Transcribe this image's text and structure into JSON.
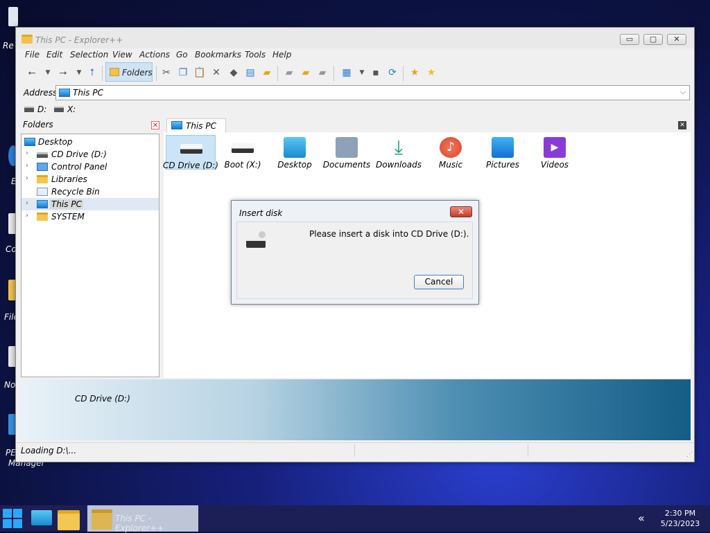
{
  "desktop": {
    "icon_labels": [
      "Re",
      "E",
      "Co",
      "File",
      "No",
      "PE",
      "Manager"
    ]
  },
  "window": {
    "title": "This PC - Explorer++",
    "controls": {
      "minimize": "▭",
      "maximize": "▢",
      "close": "✕"
    }
  },
  "menu": [
    "File",
    "Edit",
    "Selection",
    "View",
    "Actions",
    "Go",
    "Bookmarks",
    "Tools",
    "Help"
  ],
  "toolbar": {
    "folders_label": "Folders"
  },
  "address": {
    "label": "Address",
    "value": "This PC"
  },
  "drives": [
    {
      "label": "D:"
    },
    {
      "label": "X:"
    }
  ],
  "folders_pane": {
    "title": "Folders",
    "tree": [
      {
        "label": "Desktop",
        "icon": "desktop-icon",
        "level": 0,
        "expand": ""
      },
      {
        "label": "CD Drive (D:)",
        "icon": "drive-icon",
        "level": 1,
        "expand": "›"
      },
      {
        "label": "Control Panel",
        "icon": "control-panel-icon",
        "level": 1,
        "expand": "›"
      },
      {
        "label": "Libraries",
        "icon": "folder-icon",
        "level": 1,
        "expand": "›"
      },
      {
        "label": "Recycle Bin",
        "icon": "recycle-bin-icon",
        "level": 1,
        "expand": ""
      },
      {
        "label": "This PC",
        "icon": "this-pc-icon",
        "level": 1,
        "expand": "›",
        "selected": true
      },
      {
        "label": "SYSTEM",
        "icon": "folder-icon",
        "level": 1,
        "expand": "›"
      }
    ]
  },
  "tab": {
    "label": "This PC"
  },
  "items": [
    {
      "label": "CD Drive (D:)",
      "icon": "cd-drive-icon",
      "selected": true
    },
    {
      "label": "Boot (X:)",
      "icon": "drive-icon"
    },
    {
      "label": "Desktop",
      "icon": "desktop-folder-icon"
    },
    {
      "label": "Documents",
      "icon": "documents-icon"
    },
    {
      "label": "Downloads",
      "icon": "downloads-icon"
    },
    {
      "label": "Music",
      "icon": "music-icon"
    },
    {
      "label": "Pictures",
      "icon": "pictures-icon"
    },
    {
      "label": "Videos",
      "icon": "videos-icon"
    }
  ],
  "info_band": {
    "label": "CD Drive (D:)"
  },
  "status": {
    "text": "Loading D:\\..."
  },
  "dialog": {
    "title": "Insert disk",
    "message": "Please insert a disk into CD Drive (D:).",
    "cancel_label": "Cancel",
    "close_glyph": "✕"
  },
  "taskbar": {
    "active_task": "This PC - Explorer++",
    "tray_arrow": "«",
    "time": "2:30 PM",
    "date": "5/23/2023"
  }
}
